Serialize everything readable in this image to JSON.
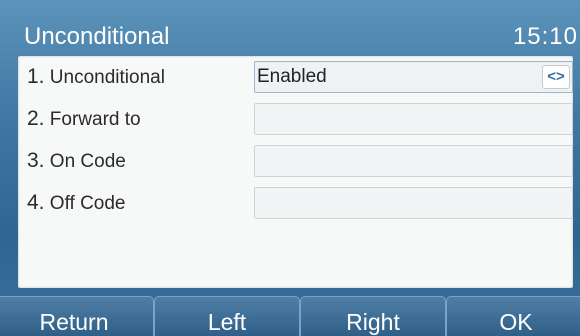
{
  "header": {
    "title": "Unconditional",
    "time": "15:10"
  },
  "rows": [
    {
      "number": "1.",
      "label": "Unconditional",
      "value": "Enabled",
      "has_toggle": true
    },
    {
      "number": "2.",
      "label": "Forward to",
      "value": ""
    },
    {
      "number": "3.",
      "label": "On Code",
      "value": ""
    },
    {
      "number": "4.",
      "label": "Off Code",
      "value": ""
    }
  ],
  "toggle_glyph": "<>",
  "softkeys": {
    "return": "Return",
    "left": "Left",
    "right": "Right",
    "ok": "OK"
  },
  "colors": {
    "background": "#3f78a4",
    "panel": "#f7f8f8",
    "accent": "#3a6e98"
  }
}
